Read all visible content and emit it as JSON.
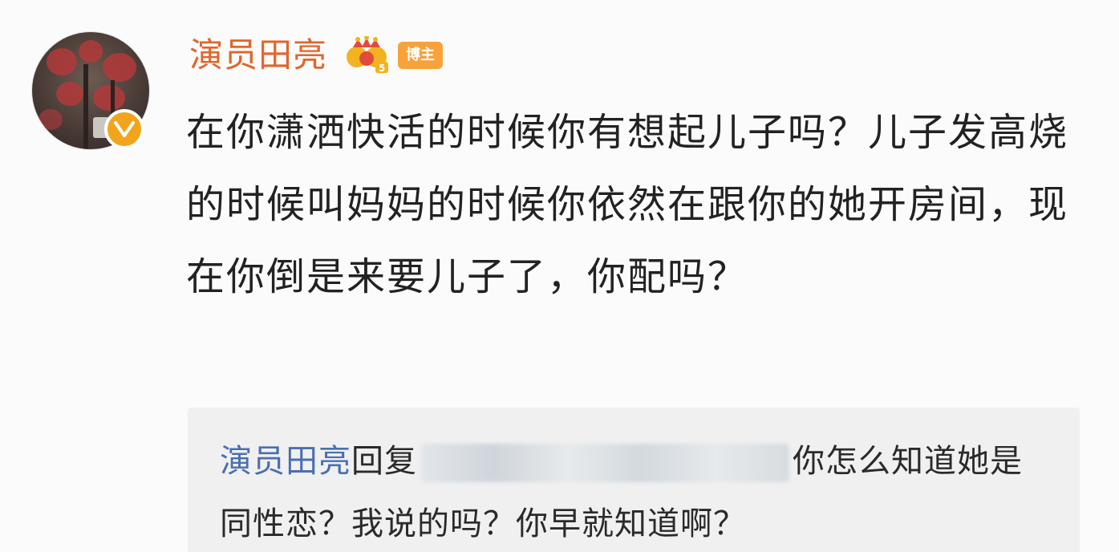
{
  "comment": {
    "username": "演员田亮",
    "badge_label": "博主",
    "crown_level": "5",
    "text": "在你潇洒快活的时候你有想起儿子吗？儿子发高烧的时候叫妈妈的时候你依然在跟你的她开房间，现在你倒是来要儿子了，你配吗？",
    "icons": {
      "crown": "crown-icon",
      "verified": "verified-v-icon"
    },
    "colors": {
      "username": "#e0662b",
      "badge": "#f7a23a",
      "verified": "#f2a51c",
      "reply_author": "#4a6fb0"
    }
  },
  "reply": {
    "author": "演员田亮",
    "action": "回复",
    "text": "你怎么知道她是同性恋？我说的吗？你早就知道啊？"
  }
}
